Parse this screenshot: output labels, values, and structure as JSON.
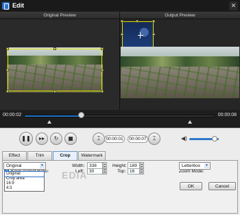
{
  "window": {
    "title": "Edit",
    "close_glyph": "✕"
  },
  "preview": {
    "left_title": "Original Preview",
    "right_title": "Output Preview"
  },
  "timeline": {
    "current_time": "00:00:02",
    "end_time": "00:00:08",
    "progress": 0.3
  },
  "playback": {
    "pause_glyph": "❚❚",
    "next_frame_glyph": "▸▸",
    "rotate_glyph": "↻",
    "clip_start_glyph": "⌶",
    "clip_end_glyph": "⌶",
    "clip_start": "00:00:01",
    "clip_end": "00:00:07",
    "volume_glyph": "◀)",
    "volume_level": 0.85
  },
  "tabs": [
    "Effect",
    "Trim",
    "Crop",
    "Watermark"
  ],
  "active_tab": "Crop",
  "crop": {
    "keep_aspect_label": "Keep Aspect Ratio:",
    "keep_aspect_checked": true,
    "left_label": "Left:",
    "left_value": "30",
    "top_label": "Top:",
    "top_value": "16",
    "width_label": "Width:",
    "width_value": "338",
    "height_label": "Height:",
    "height_value": "189",
    "zoom_label": "Zoom Mode:",
    "zoom_value": "Letterbox",
    "aspect_value": "Original",
    "aspect_options": [
      "Original",
      "Crop area",
      "16:9",
      "4:3"
    ],
    "spin_up": "▲",
    "spin_down": "▼",
    "dropdown_glyph": "▼",
    "check_glyph": "✓"
  },
  "watermark_text": "EDIA",
  "buttons": {
    "ok": "OK",
    "cancel": "Cancel"
  }
}
